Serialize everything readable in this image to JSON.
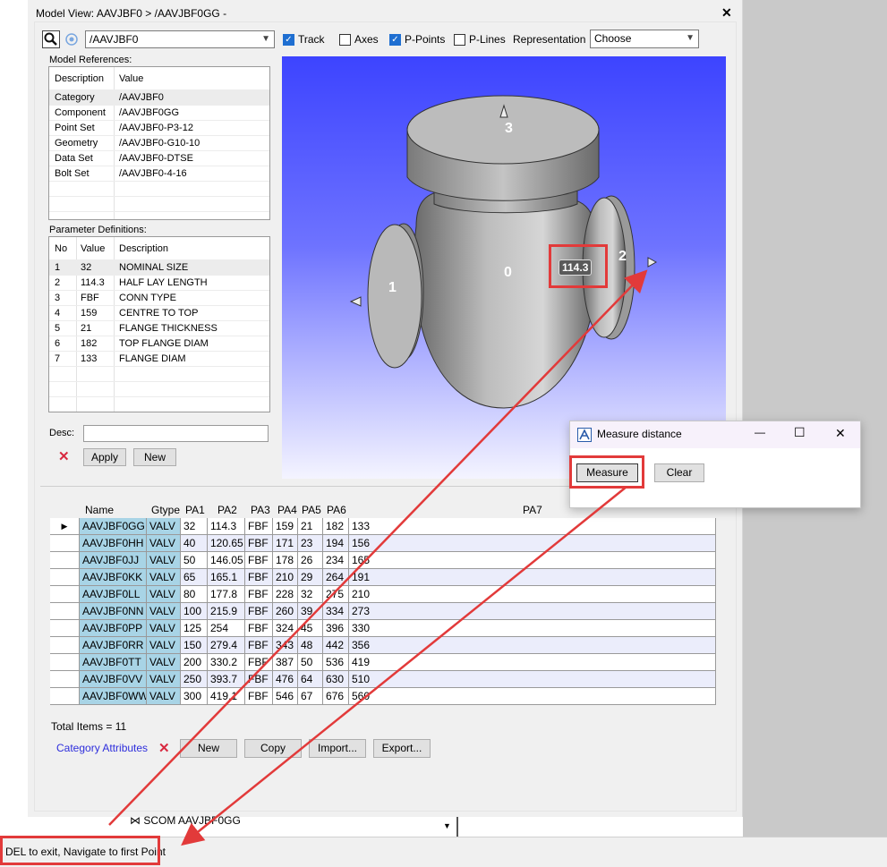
{
  "window": {
    "title": "Model View: AAVJBF0 > /AAVJBF0GG -",
    "close": "✕"
  },
  "toolbar": {
    "path_value": "/AAVJBF0",
    "track_label": "Track",
    "track_checked": true,
    "axes_label": "Axes",
    "axes_checked": false,
    "ppoints_label": "P-Points",
    "ppoints_checked": true,
    "plines_label": "P-Lines",
    "plines_checked": false,
    "representation_label": "Representation",
    "representation_value": "Choose"
  },
  "model_references": {
    "title": "Model References:",
    "headers": [
      "Description",
      "Value"
    ],
    "rows": [
      [
        "Category",
        "/AAVJBF0"
      ],
      [
        "Component",
        "/AAVJBF0GG"
      ],
      [
        "Point Set",
        "/AAVJBF0-P3-12"
      ],
      [
        "Geometry",
        "/AAVJBF0-G10-10"
      ],
      [
        "Data Set",
        "/AAVJBF0-DTSE"
      ],
      [
        "Bolt Set",
        "/AAVJBF0-4-16"
      ]
    ]
  },
  "parameter_definitions": {
    "title": "Parameter Definitions:",
    "headers": [
      "No",
      "Value",
      "Description"
    ],
    "rows": [
      [
        "1",
        "32",
        "NOMINAL SIZE"
      ],
      [
        "2",
        "114.3",
        "HALF LAY LENGTH"
      ],
      [
        "3",
        "FBF",
        "CONN TYPE"
      ],
      [
        "4",
        "159",
        "CENTRE TO TOP"
      ],
      [
        "5",
        "21",
        "FLANGE THICKNESS"
      ],
      [
        "6",
        "182",
        "TOP FLANGE DIAM"
      ],
      [
        "7",
        "133",
        "FLANGE DIAM"
      ]
    ]
  },
  "desc": {
    "label": "Desc:",
    "value": ""
  },
  "buttons": {
    "apply": "Apply",
    "new": "New",
    "delete_icon": "✕"
  },
  "viewport": {
    "point_labels": [
      "3",
      "0",
      "1",
      "2"
    ],
    "measurement": "114.3"
  },
  "table": {
    "headers": [
      "Name",
      "Gtype",
      "PA1",
      "PA2",
      "PA3",
      "PA4",
      "PA5",
      "PA6",
      "PA7"
    ],
    "rows": [
      [
        "AAVJBF0GG",
        "VALV",
        "32",
        "114.3",
        "FBF",
        "159",
        "21",
        "182",
        "133"
      ],
      [
        "AAVJBF0HH",
        "VALV",
        "40",
        "120.65",
        "FBF",
        "171",
        "23",
        "194",
        "156"
      ],
      [
        "AAVJBF0JJ",
        "VALV",
        "50",
        "146.05",
        "FBF",
        "178",
        "26",
        "234",
        "165"
      ],
      [
        "AAVJBF0KK",
        "VALV",
        "65",
        "165.1",
        "FBF",
        "210",
        "29",
        "264",
        "191"
      ],
      [
        "AAVJBF0LL",
        "VALV",
        "80",
        "177.8",
        "FBF",
        "228",
        "32",
        "275",
        "210"
      ],
      [
        "AAVJBF0NN",
        "VALV",
        "100",
        "215.9",
        "FBF",
        "260",
        "39",
        "334",
        "273"
      ],
      [
        "AAVJBF0PP",
        "VALV",
        "125",
        "254",
        "FBF",
        "324",
        "45",
        "396",
        "330"
      ],
      [
        "AAVJBF0RR",
        "VALV",
        "150",
        "279.4",
        "FBF",
        "343",
        "48",
        "442",
        "356"
      ],
      [
        "AAVJBF0TT",
        "VALV",
        "200",
        "330.2",
        "FBF",
        "387",
        "50",
        "536",
        "419"
      ],
      [
        "AAVJBF0VV",
        "VALV",
        "250",
        "393.7",
        "FBF",
        "476",
        "64",
        "630",
        "510"
      ],
      [
        "AAVJBF0WW",
        "VALV",
        "300",
        "419.1",
        "FBF",
        "546",
        "67",
        "676",
        "560"
      ]
    ]
  },
  "footer": {
    "total_items": "Total Items = 11",
    "category_attributes": "Category Attributes",
    "new": "New",
    "copy": "Copy",
    "import": "Import...",
    "export": "Export..."
  },
  "dialog": {
    "title": "Measure distance",
    "measure": "Measure",
    "clear": "Clear",
    "minimize": "—",
    "maximize": "☐",
    "close": "✕"
  },
  "tree": {
    "item": "SCOM AAVJBF0GG"
  },
  "status": {
    "text": "DEL to exit, Navigate to first Point"
  },
  "colors": {
    "highlight_red": "#e23a3a",
    "viewport_top": "#3d44ff",
    "name_cell": "#a8d4e6"
  }
}
